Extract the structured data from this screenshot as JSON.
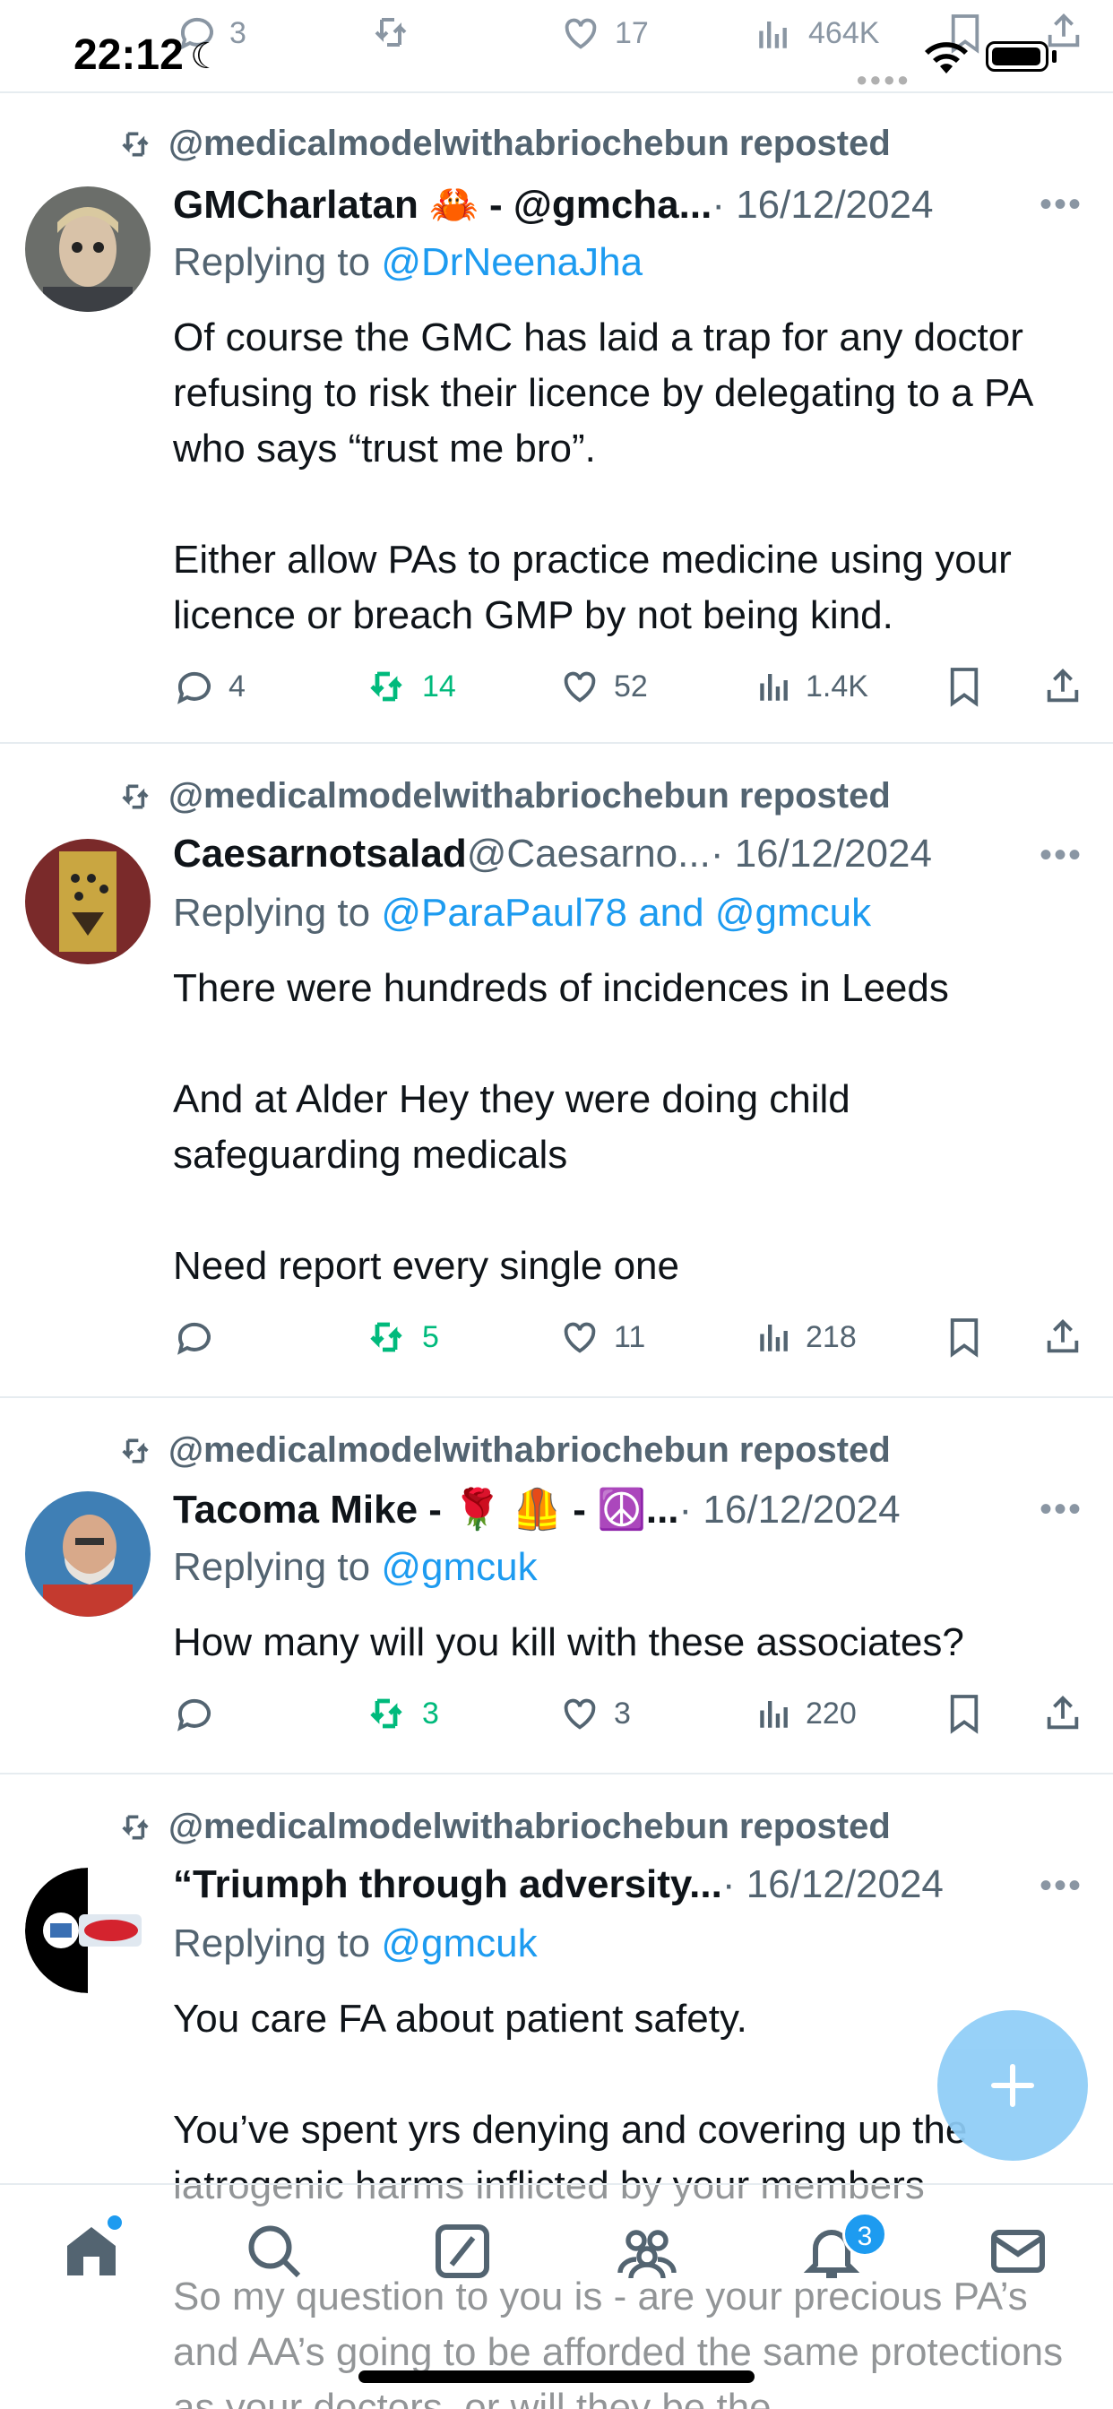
{
  "status_bar": {
    "time": "22:12"
  },
  "top_partial_actions": {
    "replies": "3",
    "likes": "17",
    "views": "464K"
  },
  "tweets": [
    {
      "reposted_by": "@medicalmodelwithabriochebun reposted",
      "name": "GMCharlatan 🦀 - @gmcha...",
      "handle": "",
      "date": "· 16/12/2024",
      "reply_prefix": "Replying to ",
      "reply_to": "@DrNeenaJha",
      "text": "Of course the GMC has laid a trap for any doctor refusing to risk their licence by delegating to a PA who says “trust me bro”.\n\nEither allow PAs to practice medicine using your licence or breach GMP by not being kind.",
      "replies": "4",
      "reposts": "14",
      "likes": "52",
      "views": "1.4K",
      "reposted_by_me": true
    },
    {
      "reposted_by": "@medicalmodelwithabriochebun reposted",
      "name": "Caesarnotsalad",
      "handle": " @Caesarno...",
      "date": " · 16/12/2024",
      "reply_prefix": "Replying to ",
      "reply_to": "@ParaPaul78 and @gmcuk",
      "text": "There were hundreds of incidences in Leeds\n\nAnd at Alder Hey they were doing child safeguarding medicals\n\nNeed report every single one",
      "replies": "",
      "reposts": "5",
      "likes": "11",
      "views": "218",
      "reposted_by_me": true
    },
    {
      "reposted_by": "@medicalmodelwithabriochebun reposted",
      "name": "Tacoma Mike - 🌹 🦺 - ☮️...",
      "handle": "",
      "date": " · 16/12/2024",
      "reply_prefix": "Replying to ",
      "reply_to": "@gmcuk",
      "text": "How many will you kill with these associates?",
      "replies": "",
      "reposts": "3",
      "likes": "3",
      "views": "220",
      "reposted_by_me": true
    },
    {
      "reposted_by": "@medicalmodelwithabriochebun reposted",
      "name": "“Triumph through adversity...",
      "handle": "",
      "date": " · 16/12/2024",
      "reply_prefix": "Replying to ",
      "reply_to": "@gmcuk",
      "text": "You care FA about patient safety.\n\nYou’ve spent yrs denying and covering up the iatrogenic harms inflicted by your members\n\nSo my question to you is - are your precious PA’s and AA’s going to be afforded the same protections as your doctors, or will they be the"
    }
  ],
  "bottom_nav": {
    "notifications_badge": "3"
  },
  "colors": {
    "link": "#1d9bf0",
    "repost_green": "#00ba7c",
    "muted": "#536471"
  },
  "icons": [
    "home-icon",
    "search-icon",
    "compose-icon",
    "communities-icon",
    "bell-icon",
    "mail-icon"
  ]
}
